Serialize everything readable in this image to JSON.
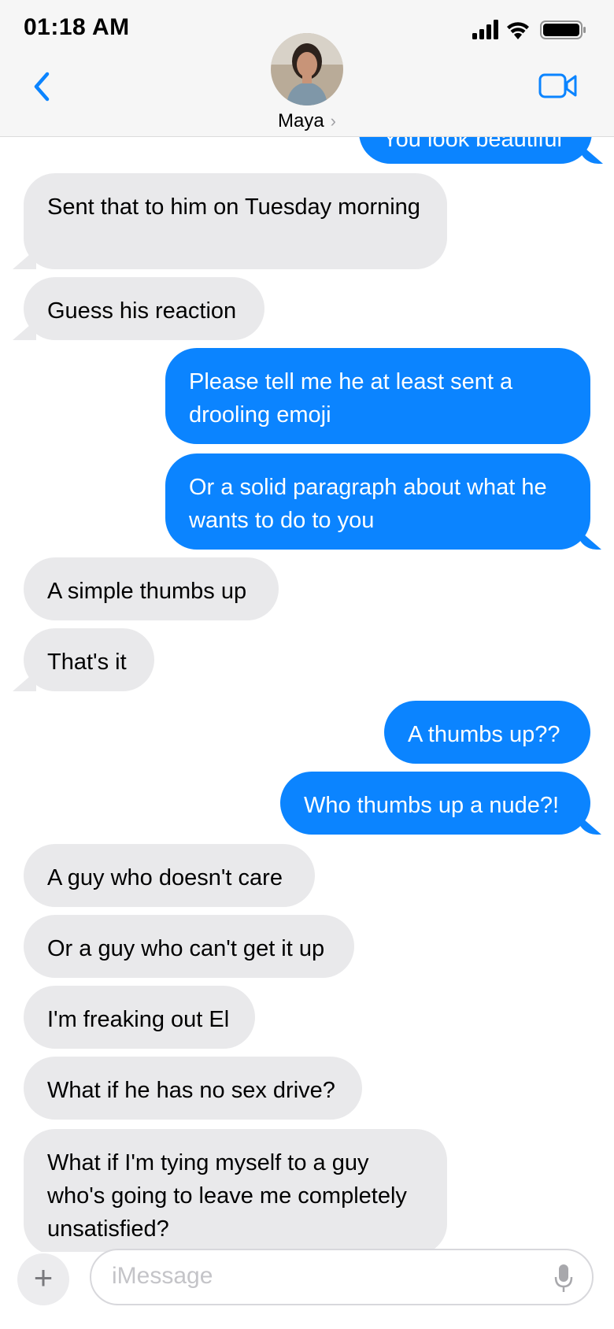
{
  "status": {
    "time": "01:18 AM"
  },
  "header": {
    "contact_name": "Maya",
    "chevron": "›"
  },
  "icons": {
    "back": "chevron-left-icon",
    "video": "video-camera-icon",
    "signal": "cellular-signal-icon",
    "wifi": "wifi-icon",
    "battery": "battery-icon",
    "mic": "microphone-icon",
    "plus": "plus-icon"
  },
  "colors": {
    "sent_bubble": "#0b84ff",
    "received_bubble": "#e9e9eb",
    "accent": "#0b84ff"
  },
  "messages": [
    {
      "from": "me",
      "text": "You look beautiful"
    },
    {
      "from": "them",
      "text": "Sent that to him on Tuesday morning"
    },
    {
      "from": "them",
      "text": "Guess his reaction"
    },
    {
      "from": "me",
      "text": "Please tell me he at least sent a drooling emoji"
    },
    {
      "from": "me",
      "text": "Or a solid paragraph about what he wants to do to you"
    },
    {
      "from": "them",
      "text": "A simple thumbs up"
    },
    {
      "from": "them",
      "text": "That's it"
    },
    {
      "from": "me",
      "text": "A thumbs up??"
    },
    {
      "from": "me",
      "text": "Who thumbs up a nude?!"
    },
    {
      "from": "them",
      "text": "A guy who doesn't care"
    },
    {
      "from": "them",
      "text": "Or a guy who can't get it up"
    },
    {
      "from": "them",
      "text": "I'm freaking out El"
    },
    {
      "from": "them",
      "text": "What if he has no sex drive?"
    },
    {
      "from": "them",
      "text": "What if I'm tying myself to a guy who's going to leave me completely unsatisfied?"
    }
  ],
  "composer": {
    "placeholder": "iMessage",
    "plus_label": "+"
  }
}
